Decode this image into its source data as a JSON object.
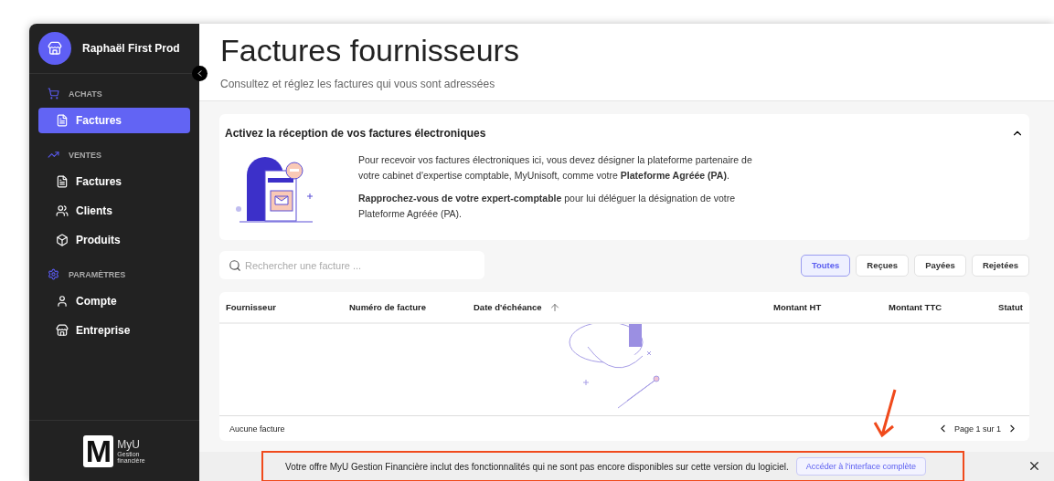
{
  "sidebar": {
    "company": "Raphaël First Prod",
    "sections": [
      {
        "title": "ACHATS",
        "items": [
          {
            "label": "Factures",
            "selected": true
          }
        ]
      },
      {
        "title": "VENTES",
        "items": [
          {
            "label": "Factures",
            "selected": false
          },
          {
            "label": "Clients",
            "selected": false
          },
          {
            "label": "Produits",
            "selected": false
          }
        ]
      },
      {
        "title": "PARAMÈTRES",
        "items": [
          {
            "label": "Compte",
            "selected": false
          },
          {
            "label": "Entreprise",
            "selected": false
          }
        ]
      }
    ],
    "logo": {
      "letter": "M",
      "name": "MyU",
      "subtitle_lines": [
        "Gestion",
        "financière"
      ]
    }
  },
  "header": {
    "title": "Factures fournisseurs",
    "subtitle": "Consultez et réglez les factures qui vous sont adressées"
  },
  "notice": {
    "title": "Activez la réception de vos factures électroniques",
    "expanded": true,
    "paragraphs": [
      "Pour recevoir vos factures électroniques ici, vous devez désigner la plateforme partenaire de votre cabinet d'expertise comptable, MyUnisoft, comme votre **Plateforme Agréée (PA)**.",
      "**Rapprochez-vous de votre expert-comptable** pour lui déléguer la désignation de votre Plateforme Agréée (PA)."
    ]
  },
  "search": {
    "placeholder": "Rechercher une facture ..."
  },
  "filters": [
    {
      "label": "Toutes",
      "selected": true
    },
    {
      "label": "Reçues",
      "selected": false
    },
    {
      "label": "Payées",
      "selected": false
    },
    {
      "label": "Rejetées",
      "selected": false
    }
  ],
  "table": {
    "columns": [
      {
        "label": "Fournisseur",
        "sorted": false
      },
      {
        "label": "Numéro de facture",
        "sorted": false
      },
      {
        "label": "Date d'échéance",
        "sorted": true
      },
      {
        "label": "Montant HT",
        "sorted": false
      },
      {
        "label": "Montant TTC",
        "sorted": false
      },
      {
        "label": "Statut",
        "sorted": false
      }
    ],
    "empty_text": "Aucune facture",
    "pagination": "Page 1 sur 1"
  },
  "banner": {
    "text": "Votre offre MyU Gestion Financière inclut des fonctionnalités qui ne sont pas encore disponibles sur cette version du logiciel.",
    "button": "Accéder à l'interface complète"
  }
}
